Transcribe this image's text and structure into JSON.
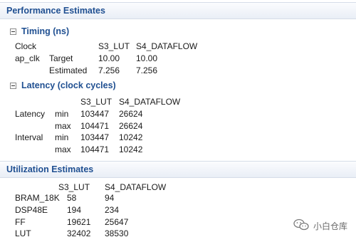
{
  "performance": {
    "title": "Performance Estimates",
    "timing": {
      "title": "Timing (ns)",
      "header": {
        "col0": "Clock",
        "col1": "S3_LUT",
        "col2": "S4_DATAFLOW"
      },
      "clock": "ap_clk",
      "rows": [
        {
          "label": "Target",
          "s3": "10.00",
          "s4": "10.00"
        },
        {
          "label": "Estimated",
          "s3": "7.256",
          "s4": "7.256"
        }
      ]
    },
    "latency": {
      "title": "Latency (clock cycles)",
      "header": {
        "col1": "S3_LUT",
        "col2": "S4_DATAFLOW"
      },
      "rows": [
        {
          "group": "Latency",
          "kind": "min",
          "s3": "103447",
          "s4": "26624"
        },
        {
          "group": "",
          "kind": "max",
          "s3": "104471",
          "s4": "26624"
        },
        {
          "group": "Interval",
          "kind": "min",
          "s3": "103447",
          "s4": "10242"
        },
        {
          "group": "",
          "kind": "max",
          "s3": "104471",
          "s4": "10242"
        }
      ]
    }
  },
  "utilization": {
    "title": "Utilization Estimates",
    "header": {
      "col1": "S3_LUT",
      "col2": "S4_DATAFLOW"
    },
    "rows": [
      {
        "label": "BRAM_18K",
        "s3": "58",
        "s4": "94"
      },
      {
        "label": "DSP48E",
        "s3": "194",
        "s4": "234"
      },
      {
        "label": "FF",
        "s3": "19621",
        "s4": "25647"
      },
      {
        "label": "LUT",
        "s3": "32402",
        "s4": "38530"
      }
    ]
  },
  "watermark": {
    "text": "小白仓库",
    "icon": "wechat-icon"
  }
}
